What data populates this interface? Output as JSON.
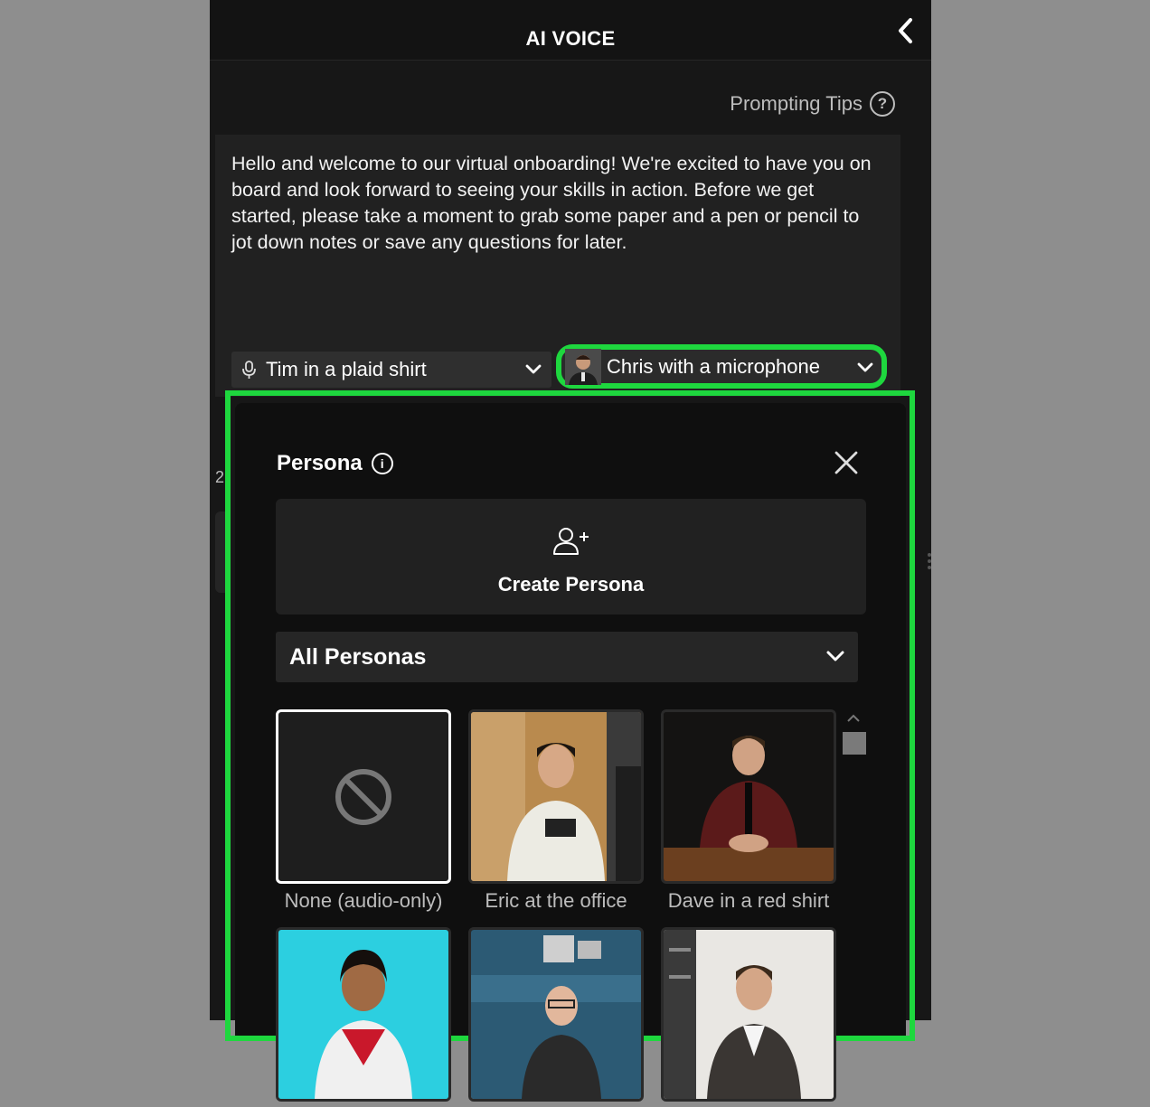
{
  "header": {
    "title": "AI VOICE",
    "back_icon": "chevron-left-icon"
  },
  "prompting_tips": {
    "label": "Prompting Tips",
    "icon": "question-circle-icon"
  },
  "script": {
    "text": "Hello and welcome to our virtual onboarding! We're excited to have you on board and look forward to seeing your skills in action. Before we get started, please take a moment to grab some paper and a pen or pencil to jot down notes or save any questions for later."
  },
  "voice_select": {
    "value": "Tim in a plaid shirt",
    "icon": "microphone-icon"
  },
  "persona_select": {
    "value": "Chris with a microphone"
  },
  "side_peek": {
    "text": "2"
  },
  "persona_popup": {
    "title": "Persona",
    "create_label": "Create Persona",
    "filter_value": "All Personas",
    "personas": [
      {
        "name": "None (audio-only)",
        "selected": true
      },
      {
        "name": "Eric at the office",
        "selected": false
      },
      {
        "name": "Dave in a red shirt",
        "selected": false
      },
      {
        "name": "",
        "selected": false
      },
      {
        "name": "",
        "selected": false
      },
      {
        "name": "",
        "selected": false
      }
    ]
  },
  "colors": {
    "highlight": "#1ed73e",
    "panel": "#171717",
    "card": "#212121"
  }
}
